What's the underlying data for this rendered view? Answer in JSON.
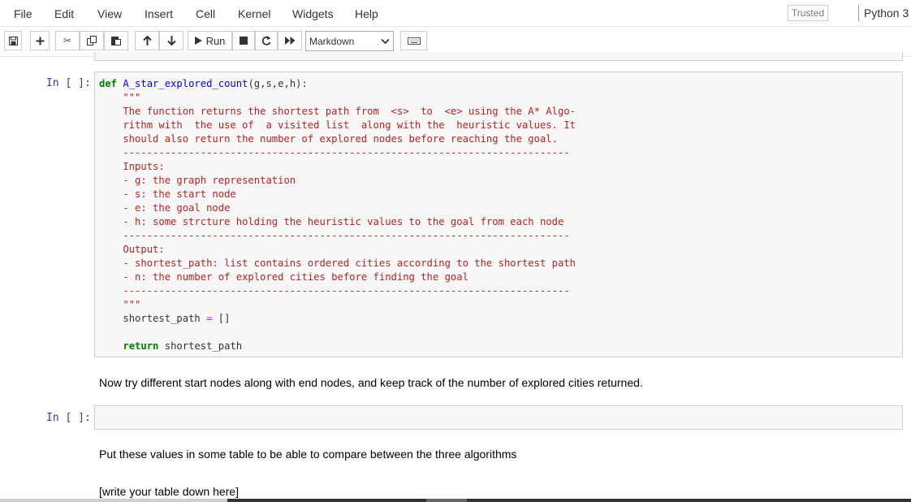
{
  "menu": {
    "items": [
      "File",
      "Edit",
      "View",
      "Insert",
      "Cell",
      "Kernel",
      "Widgets",
      "Help"
    ],
    "trusted": "Trusted",
    "kernel": "Python 3"
  },
  "toolbar": {
    "run_label": "Run",
    "cell_type": "Markdown",
    "icons": [
      "save-icon",
      "plus-icon",
      "cut-icon",
      "copy-icon",
      "paste-icon",
      "arrow-up-icon",
      "arrow-down-icon",
      "run-icon",
      "stop-icon",
      "restart-icon",
      "fast-forward-icon",
      "keyboard-icon"
    ]
  },
  "cells": {
    "code_prompt": "In [ ]:",
    "code": {
      "def_kw": "def",
      "func_name": "A_star_explored_count",
      "signature": "(g,s,e,h):",
      "docstring": "    \"\"\"\n    The function returns the shortest path from  <s>  to  <e> using the A* Algo-\n    rithm with  the use of  a visited list  along with the  heuristic values. It\n    should also return the number of explored nodes before reaching the goal.\n    ---------------------------------------------------------------------------\n    Inputs:\n    - g: the graph representation\n    - s: the start node\n    - e: the goal node\n    - h: some strcture holding the heuristic values to the goal from each node\n    ---------------------------------------------------------------------------\n    Output:\n    - shortest_path: list contains ordered cities according to the shortest path\n    - n: the number of explored cities before finding the goal\n    ---------------------------------------------------------------------------\n    \"\"\"",
      "assign_var": "shortest_path",
      "assign_op": "=",
      "assign_val": "[]",
      "return_kw": "return",
      "return_val": "shortest_path"
    },
    "markdown_1": "Now try different start nodes along with end nodes, and keep track of the number of explored cities returned.",
    "empty_prompt": "In [ ]:",
    "markdown_2": "Put these values in some table to be able to compare between the three algorithms",
    "markdown_3": "[write your table down here]"
  }
}
